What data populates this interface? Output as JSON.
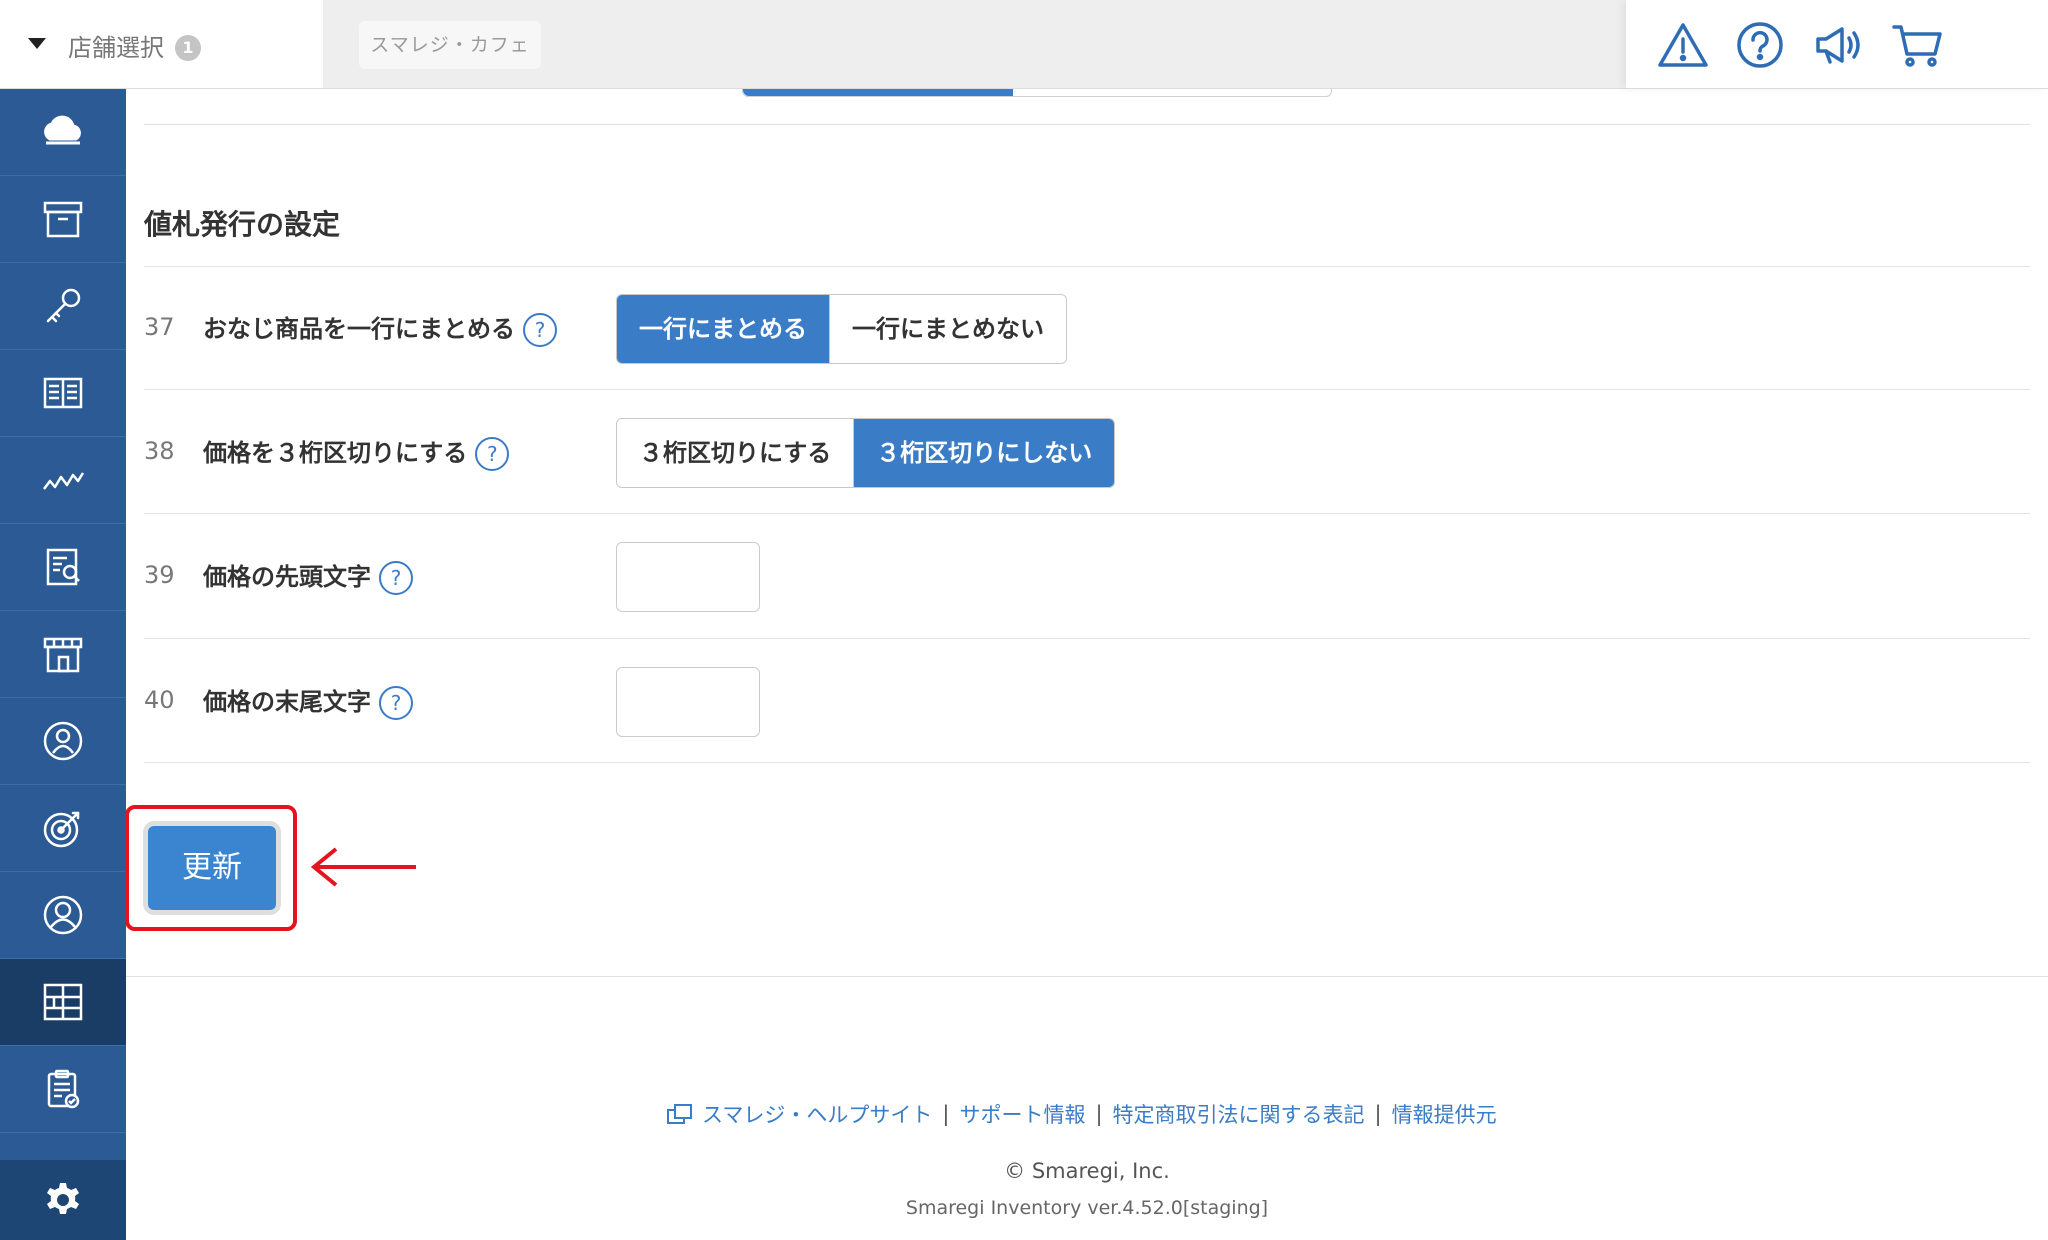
{
  "header": {
    "store_select_label": "店舗選択",
    "store_select_count": "1",
    "current_store": "スマレジ・カフェ",
    "icons": [
      "warning-icon",
      "help-circle-icon",
      "megaphone-icon",
      "cart-icon"
    ]
  },
  "sidebar": {
    "items": [
      {
        "icon": "cloud-icon"
      },
      {
        "icon": "archive-box-icon"
      },
      {
        "icon": "key-icon"
      },
      {
        "icon": "book-icon"
      },
      {
        "icon": "trend-chart-icon"
      },
      {
        "icon": "report-search-icon"
      },
      {
        "icon": "store-icon"
      },
      {
        "icon": "customer-icon"
      },
      {
        "icon": "target-icon"
      },
      {
        "icon": "staff-icon"
      },
      {
        "icon": "layout-grid-icon",
        "active": true
      },
      {
        "icon": "clipboard-check-icon"
      }
    ],
    "bottom_icon": "gear-icon"
  },
  "section": {
    "title": "値札発行の設定",
    "rows": [
      {
        "number": "37",
        "label": "おなじ商品を一行にまとめる",
        "help": "?",
        "options": [
          "一行にまとめる",
          "一行にまとめない"
        ],
        "selected": 0
      },
      {
        "number": "38",
        "label": "価格を３桁区切りにする",
        "help": "?",
        "options": [
          "３桁区切りにする",
          "３桁区切りにしない"
        ],
        "selected": 1
      },
      {
        "number": "39",
        "label": "価格の先頭文字",
        "help": "?",
        "value": ""
      },
      {
        "number": "40",
        "label": "価格の末尾文字",
        "help": "?",
        "value": ""
      }
    ]
  },
  "actions": {
    "update_label": "更新"
  },
  "annotation": {
    "highlight_color": "#e4141e"
  },
  "footer": {
    "links": [
      "スマレジ・ヘルプサイト",
      "サポート情報",
      "特定商取引法に関する表記",
      "情報提供元"
    ],
    "separator": "|",
    "copyright": "© Smaregi, Inc.",
    "version": "Smaregi Inventory ver.4.52.0[staging]"
  },
  "colors": {
    "sidebar": "#2b5a94",
    "sidebar_active": "#1a3d66",
    "accent": "#3a7cc6",
    "update_button": "#3a84d0"
  }
}
